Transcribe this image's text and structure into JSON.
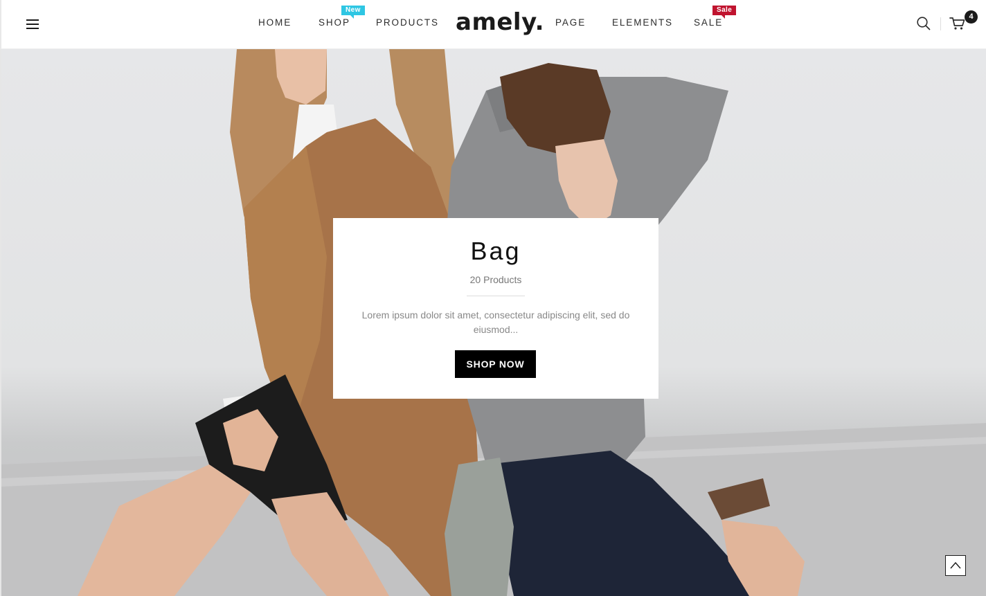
{
  "header": {
    "brand": "amely.",
    "nav": [
      {
        "label": "HOME"
      },
      {
        "label": "SHOP",
        "badge": "New"
      },
      {
        "label": "PRODUCTS"
      },
      {
        "label": "PAGE"
      },
      {
        "label": "ELEMENTS"
      },
      {
        "label": "SALE",
        "badge": "Sale"
      }
    ],
    "cart_count": "4",
    "icons": {
      "menu": "hamburger-menu-icon",
      "search": "search-icon",
      "cart": "shopping-cart-icon"
    }
  },
  "promo": {
    "title": "Bag",
    "count": "20 Products",
    "description": "Lorem ipsum dolor sit amet, consectetur adipiscing elit, sed do eiusmod...",
    "button": "SHOP NOW"
  },
  "colors": {
    "badge_new": "#2ec6e3",
    "badge_sale": "#c0142f",
    "button_bg": "#000000",
    "text_dark": "#111111"
  }
}
